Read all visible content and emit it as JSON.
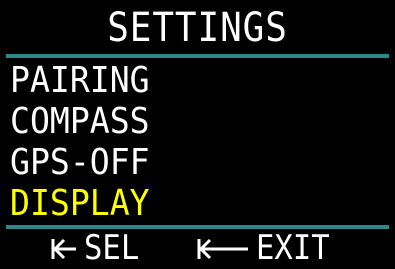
{
  "colors": {
    "background": "#000000",
    "text": "#ffffff",
    "selected": "#ffff00",
    "rule": "#2a8a8a"
  },
  "header": {
    "title": "SETTINGS"
  },
  "menu": {
    "items": [
      {
        "label": "PAIRING",
        "selected": false
      },
      {
        "label": "COMPASS",
        "selected": false
      },
      {
        "label": "GPS-OFF",
        "selected": false
      },
      {
        "label": "DISPLAY",
        "selected": true
      }
    ]
  },
  "footer": {
    "select_icon": "short-left-arrow-icon",
    "select_label": "SEL",
    "exit_icon": "long-left-arrow-icon",
    "exit_label": "EXIT"
  }
}
